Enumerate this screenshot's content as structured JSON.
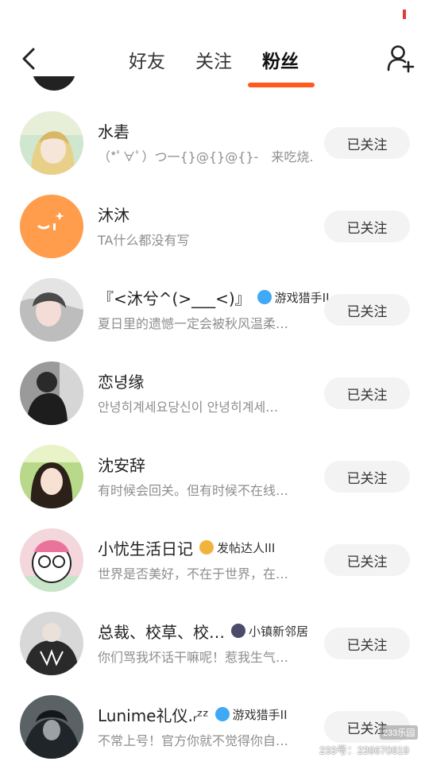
{
  "header": {
    "tabs": [
      {
        "label": "好友",
        "active": false
      },
      {
        "label": "关注",
        "active": false
      },
      {
        "label": "粉丝",
        "active": true
      }
    ],
    "back_icon": "chevron-left-icon",
    "add_friend_icon": "add-user-icon",
    "accent_color": "#ff5a1f"
  },
  "followers": [
    {
      "name": "水砉",
      "subtitle": "（*ﾟ∀ﾟ）つ一{}@{}@{}-　来吃烧…",
      "button": "已关注"
    },
    {
      "name": "沐沐",
      "subtitle": "TA什么都没有写",
      "button": "已关注"
    },
    {
      "name": "『<沐兮^(>___<)』",
      "badge": "游戏猎手II",
      "subtitle": "夏日里的遗憾一定会被秋风温柔…",
      "button": "已关注"
    },
    {
      "name": "恋녕缘",
      "subtitle": "안녕히계세요당신이 안녕히계세…",
      "button": "已关注"
    },
    {
      "name": "沈安辞",
      "subtitle": "有时候会回关。但有时候不在线…",
      "button": "已关注"
    },
    {
      "name": "小忧生活日记",
      "badge": "发帖达人III",
      "subtitle": "世界是否美好，不在于世界，在…",
      "button": "已关注"
    },
    {
      "name": "总裁、校草、校…",
      "badge": "小镇新邻居",
      "subtitle": "你们骂我坏话干嘛呢！惹我生气…",
      "button": "已关注"
    },
    {
      "name": "Lunime礼仪.ᵣᶻᶻ",
      "badge": "游戏猎手II",
      "subtitle": "不常上号！官方你就不觉得你自…",
      "button": "已关注"
    }
  ],
  "watermark": {
    "logo": "233乐园",
    "text": "233号：239670619"
  }
}
